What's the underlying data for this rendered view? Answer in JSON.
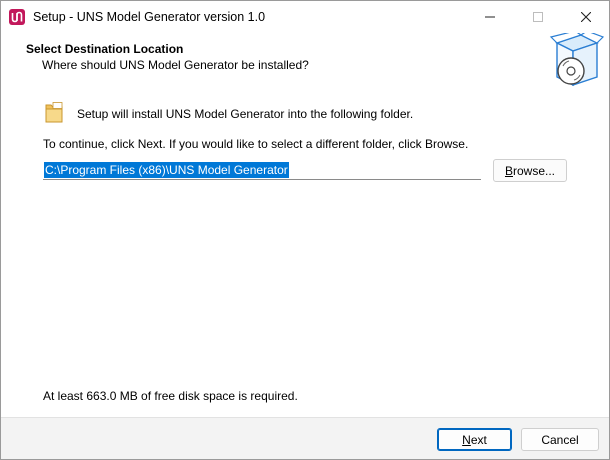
{
  "window": {
    "title": "Setup - UNS Model Generator version 1.0"
  },
  "header": {
    "title": "Select Destination Location",
    "subtitle": "Where should UNS Model Generator be installed?"
  },
  "main": {
    "install_message": "Setup will install UNS Model Generator into the following folder.",
    "continue_message": "To continue, click Next. If you would like to select a different folder, click Browse.",
    "destination_path": "C:\\Program Files (x86)\\UNS Model Generator",
    "browse": {
      "mnemonic": "B",
      "rest": "rowse..."
    },
    "disk_space_message": "At least 663.0 MB of free disk space is required."
  },
  "footer": {
    "next": {
      "mnemonic": "N",
      "rest": "ext"
    },
    "cancel_label": "Cancel"
  },
  "colors": {
    "selection": "#0078d7",
    "default_button_border": "#0067c0",
    "footer_background": "#f3f3f3",
    "app_icon": "#c2185b"
  },
  "icons": {
    "app": "uns-logo-icon",
    "header": "setup-box-cd-icon",
    "folder": "folder-icon",
    "minimize": "minimize-icon",
    "maximize": "maximize-icon",
    "close": "close-icon"
  }
}
